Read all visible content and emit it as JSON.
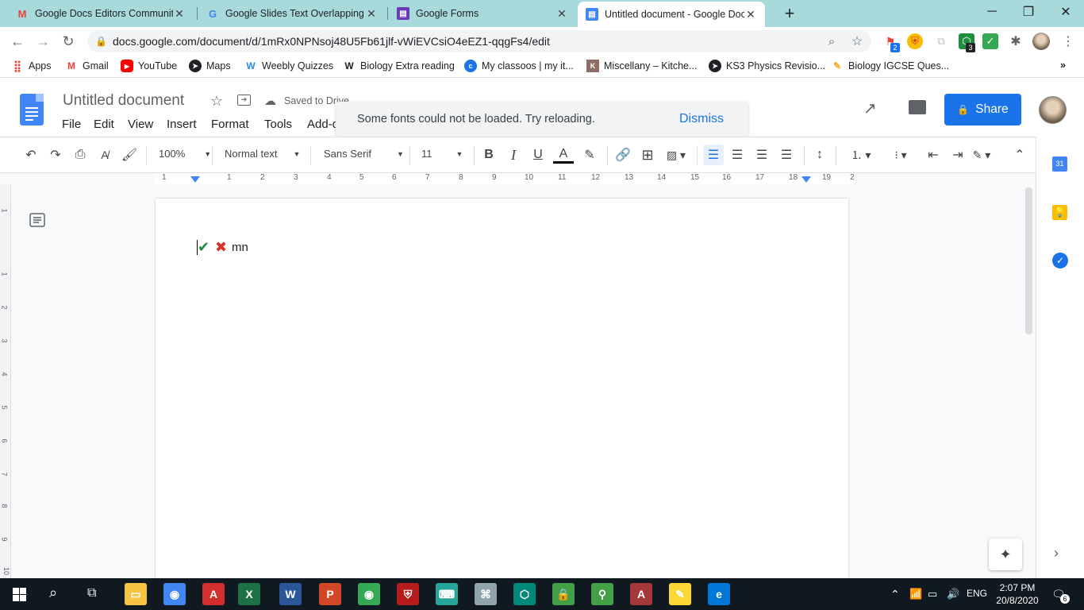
{
  "browser": {
    "tabs": [
      {
        "title": "Google Docs Editors Community",
        "icon": "gmail-icon",
        "color": "#ea4335",
        "glyph": "M"
      },
      {
        "title": "Google Slides Text Overlapping -",
        "icon": "google-icon",
        "color": "#4285f4",
        "glyph": "G"
      },
      {
        "title": "Google Forms",
        "icon": "forms-icon",
        "color": "#673ab7",
        "glyph": "▤"
      },
      {
        "title": "Untitled document - Google Doc",
        "icon": "docs-icon",
        "color": "#4285f4",
        "glyph": "▤"
      }
    ],
    "new_tab": "+",
    "window": {
      "minimize": "─",
      "restore": "❐",
      "close": "✕"
    },
    "url": "docs.google.com/document/d/1mRx0NPNsoj48U5Fb61jlf-vWiEVCsiO4eEZ1-qqgFs4/edit",
    "ext_badges": {
      "first": "2",
      "second": "3"
    },
    "bookmarks": [
      {
        "label": "Apps",
        "icon": "apps-grid-icon",
        "color": "#ea4335"
      },
      {
        "label": "Gmail",
        "icon": "gmail-icon",
        "color": "#ea4335"
      },
      {
        "label": "YouTube",
        "icon": "youtube-icon",
        "color": "#ff0000"
      },
      {
        "label": "Maps",
        "icon": "maps-icon",
        "color": "#202124"
      },
      {
        "label": "Weebly Quizzes",
        "icon": "weebly-icon",
        "color": "#2990ea"
      },
      {
        "label": "Biology Extra reading",
        "icon": "weebly-icon",
        "color": "#202124"
      },
      {
        "label": "My classoos | my it...",
        "icon": "classoos-icon",
        "color": "#1a73e8"
      },
      {
        "label": "Miscellany – Kitche...",
        "icon": "kitchen-icon",
        "color": "#8d6e63"
      },
      {
        "label": "KS3 Physics Revisio...",
        "icon": "physics-icon",
        "color": "#202124"
      },
      {
        "label": "Biology IGCSE Ques...",
        "icon": "biology-icon",
        "color": "#f9a825"
      }
    ],
    "bookmarks_more": "»"
  },
  "docs": {
    "title": "Untitled document",
    "saved_status": "Saved to Drive",
    "menus": [
      "File",
      "Edit",
      "View",
      "Insert",
      "Format",
      "Tools",
      "Add-ons"
    ],
    "toast": {
      "message": "Some fonts could not be loaded. Try reloading.",
      "action": "Dismiss"
    },
    "share_label": "Share",
    "toolbar": {
      "zoom": "100%",
      "style": "Normal text",
      "font": "Sans Serif",
      "size": "11"
    },
    "ruler_numbers": [
      "1",
      "1",
      "2",
      "3",
      "4",
      "5",
      "6",
      "7",
      "8",
      "9",
      "10",
      "11",
      "12",
      "13",
      "14",
      "15",
      "16",
      "17",
      "18",
      "19",
      "2"
    ],
    "vruler_numbers": [
      "1",
      "1",
      "2",
      "3",
      "4",
      "5",
      "6",
      "7",
      "8",
      "9",
      "10"
    ],
    "content": {
      "check": "✔",
      "cross": "✖",
      "text": "mn"
    },
    "side_calendar": "31"
  },
  "taskbar": {
    "time": "2:07 PM",
    "date": "20/8/2020",
    "lang": "ENG",
    "notifications": "6",
    "apps": [
      {
        "name": "file-explorer-icon",
        "color": "#f6c343",
        "glyph": "▭"
      },
      {
        "name": "chrome-icon",
        "color": "#4285f4",
        "glyph": "◉"
      },
      {
        "name": "acrobat-icon",
        "color": "#d32f2f",
        "glyph": "A"
      },
      {
        "name": "excel-icon",
        "color": "#1e7145",
        "glyph": "X"
      },
      {
        "name": "word-icon",
        "color": "#2b579a",
        "glyph": "W"
      },
      {
        "name": "powerpoint-icon",
        "color": "#d24726",
        "glyph": "P"
      },
      {
        "name": "chrome-icon",
        "color": "#34a853",
        "glyph": "◉"
      },
      {
        "name": "shield-icon",
        "color": "#b71c1c",
        "glyph": "⛨"
      },
      {
        "name": "keyboard-icon",
        "color": "#26a69a",
        "glyph": "⌨"
      },
      {
        "name": "network-icon",
        "color": "#90a4ae",
        "glyph": "⌘"
      },
      {
        "name": "hex-icon",
        "color": "#00897b",
        "glyph": "⬡"
      },
      {
        "name": "lock-icon",
        "color": "#43a047",
        "glyph": "🔒"
      },
      {
        "name": "pin-icon",
        "color": "#43a047",
        "glyph": "⚲"
      },
      {
        "name": "access-icon",
        "color": "#a4373a",
        "glyph": "A"
      },
      {
        "name": "pen-icon",
        "color": "#fdd835",
        "glyph": "✎"
      },
      {
        "name": "edge-icon",
        "color": "#0078d7",
        "glyph": "e"
      }
    ]
  }
}
